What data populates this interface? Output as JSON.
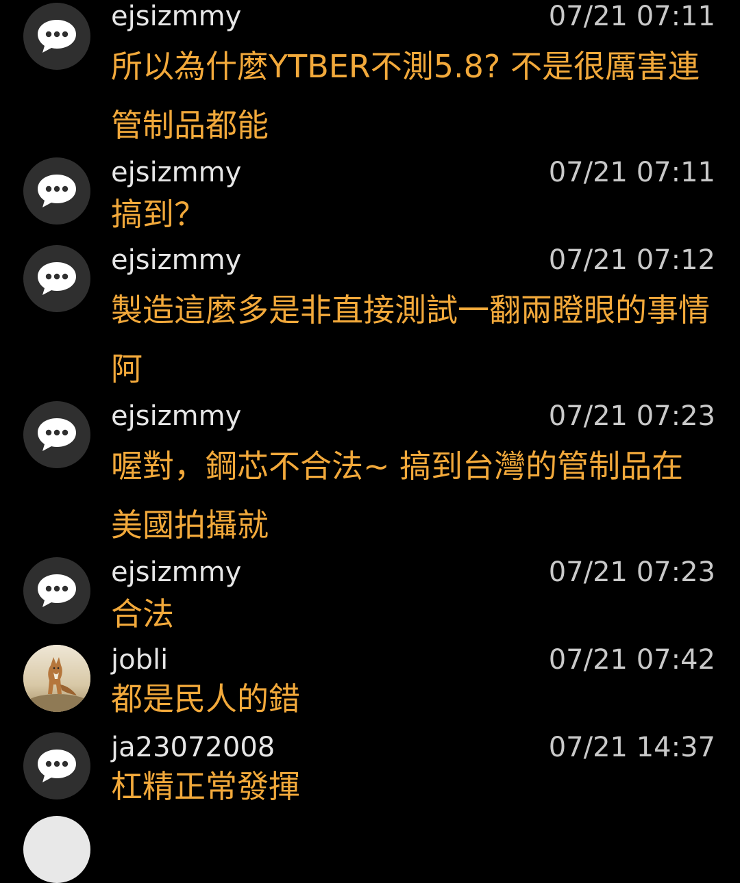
{
  "icons": {
    "default_avatar": "comment-bubble-icon",
    "photo_avatar": "fox-photo"
  },
  "colors": {
    "background": "#000000",
    "username": "#e6e6e6",
    "timestamp": "#c9c9c9",
    "message": "#f2a93b",
    "avatar_bg": "#2f2f2f"
  },
  "comments": [
    {
      "username": "ejsizmmy",
      "timestamp": "07/21 07:11",
      "text": "所以為什麼YTBER不測5.8? 不是很厲害連管制品都能"
    },
    {
      "username": "ejsizmmy",
      "timestamp": "07/21 07:11",
      "text": "搞到？"
    },
    {
      "username": "ejsizmmy",
      "timestamp": "07/21 07:12",
      "text": "製造這麼多是非直接測試一翻兩瞪眼的事情阿"
    },
    {
      "username": "ejsizmmy",
      "timestamp": "07/21 07:23",
      "text": "喔對，鋼芯不合法~ 搞到台灣的管制品在美國拍攝就"
    },
    {
      "username": "ejsizmmy",
      "timestamp": "07/21 07:23",
      "text": "合法"
    },
    {
      "username": "jobli",
      "timestamp": "07/21 07:42",
      "text": "都是民人的錯"
    },
    {
      "username": "ja23072008",
      "timestamp": "07/21 14:37",
      "text": "杠精正常發揮"
    }
  ]
}
